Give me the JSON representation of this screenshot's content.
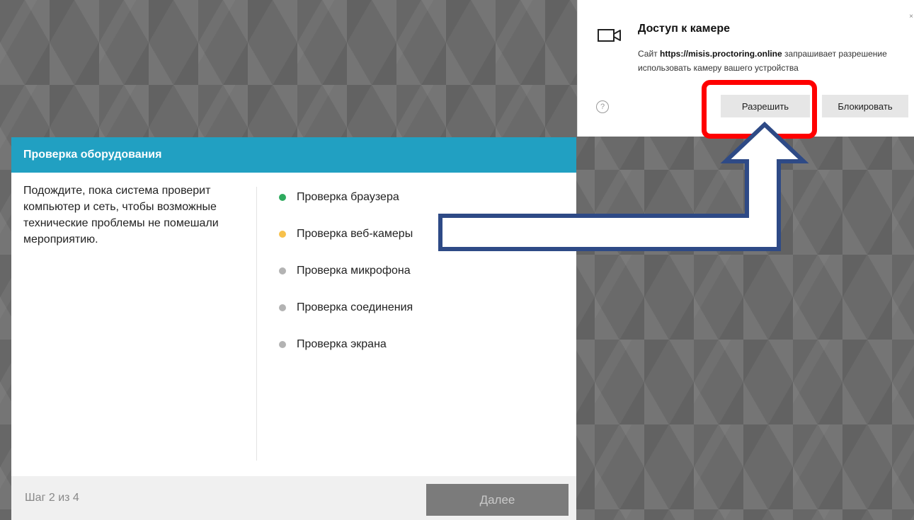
{
  "panel": {
    "header_title": "Проверка оборудования",
    "intro_text": "Подождите, пока система проверит компьютер и сеть, чтобы возможные технические проблемы не помешали мероприятию.",
    "checks": [
      {
        "label": "Проверка браузера",
        "status_color": "#2eaa5e"
      },
      {
        "label": "Проверка веб-камеры",
        "status_color": "#f7c14b"
      },
      {
        "label": "Проверка микрофона",
        "status_color": "#b3b3b3"
      },
      {
        "label": "Проверка соединения",
        "status_color": "#b3b3b3"
      },
      {
        "label": "Проверка экрана",
        "status_color": "#b3b3b3"
      }
    ],
    "footer": {
      "step_text": "Шаг 2 из 4",
      "next_label": "Далее"
    }
  },
  "camera_popup": {
    "title": "Доступ к камере",
    "text_prefix": "Сайт ",
    "site_url": "https://misis.proctoring.online",
    "text_suffix": " запрашивает разрешение использовать камеру вашего устройства",
    "allow_label": "Разрешить",
    "block_label": "Блокировать",
    "close_glyph": "×",
    "help_glyph": "?",
    "icon": "video-camera-icon"
  },
  "annotation": {
    "highlight_color": "#ff0000",
    "arrow_color": "#2e4a86"
  }
}
